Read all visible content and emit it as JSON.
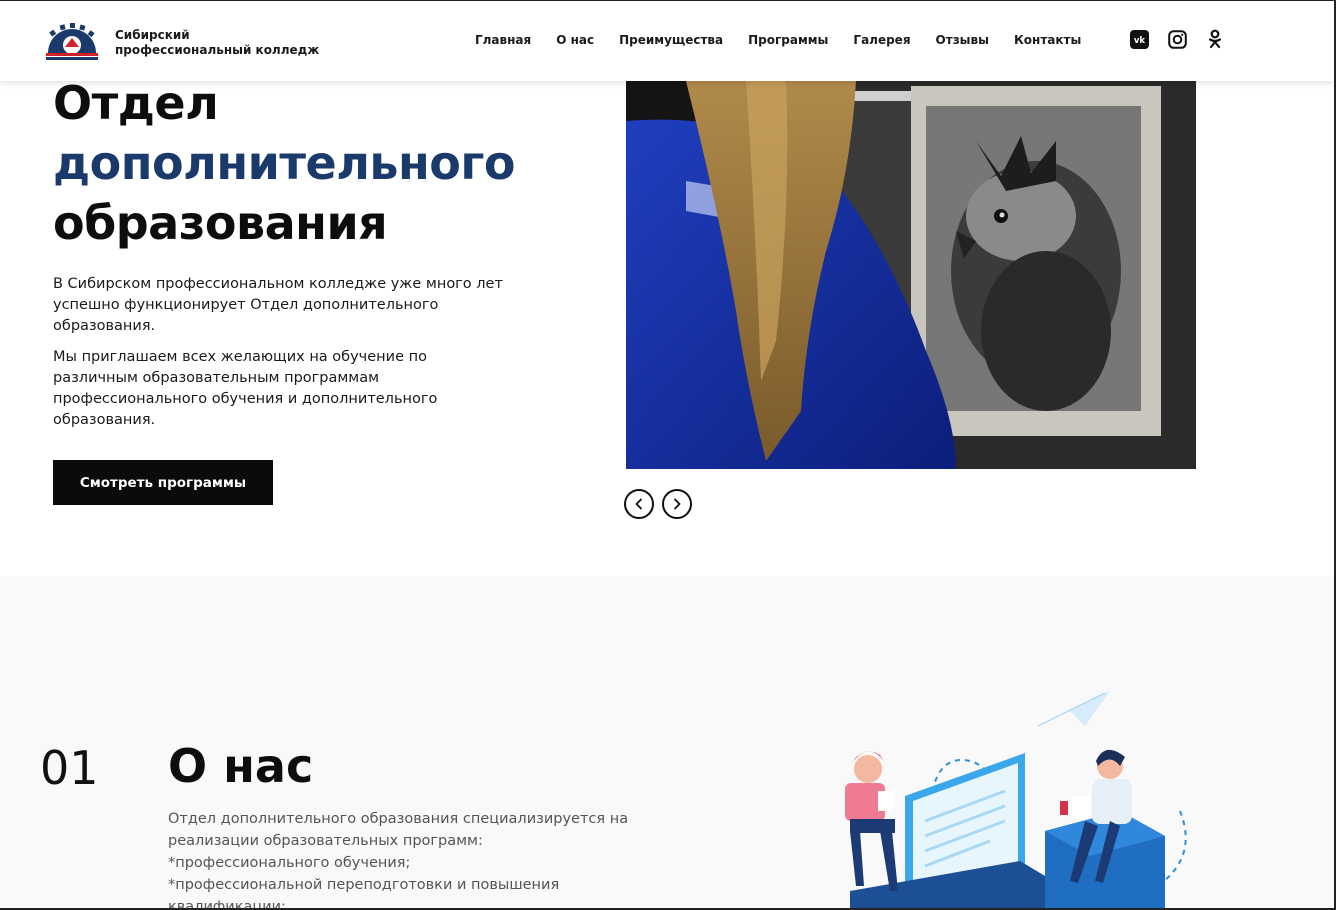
{
  "header": {
    "brand_line1": "Сибирский",
    "brand_line2": "профессиональный колледж",
    "nav": [
      "Главная",
      "О нас",
      "Преимущества",
      "Программы",
      "Галерея",
      "Отзывы",
      "Контакты"
    ],
    "social_icons": [
      "vk-icon",
      "instagram-icon",
      "odnoklassniki-icon"
    ]
  },
  "hero": {
    "title_line1": "Отдел",
    "title_line2": "дополнительного",
    "title_line3": "образования",
    "paragraph1": "В Сибирском профессиональном колледже уже много лет успешно функционирует Отдел дополнительного образования.",
    "paragraph2": "Мы приглашаем всех желающих на обучение по различным образовательным программам профессионального обучения и дополнительного образования.",
    "cta_label": "Смотреть программы",
    "prev_icon": "chevron-left-icon",
    "next_icon": "chevron-right-icon"
  },
  "about": {
    "number": "01",
    "title": "О нас",
    "text_line1": "Отдел дополнительного образования специализируется на",
    "text_line2": "реализации образовательных программ:",
    "text_line3": "*профессионального обучения;",
    "text_line4": "*профессиональной переподготовки и повышения",
    "text_line5": "квалификации;"
  },
  "colors": {
    "accent_blue": "#1a3a6b",
    "button_bg": "#0b0b0b"
  }
}
